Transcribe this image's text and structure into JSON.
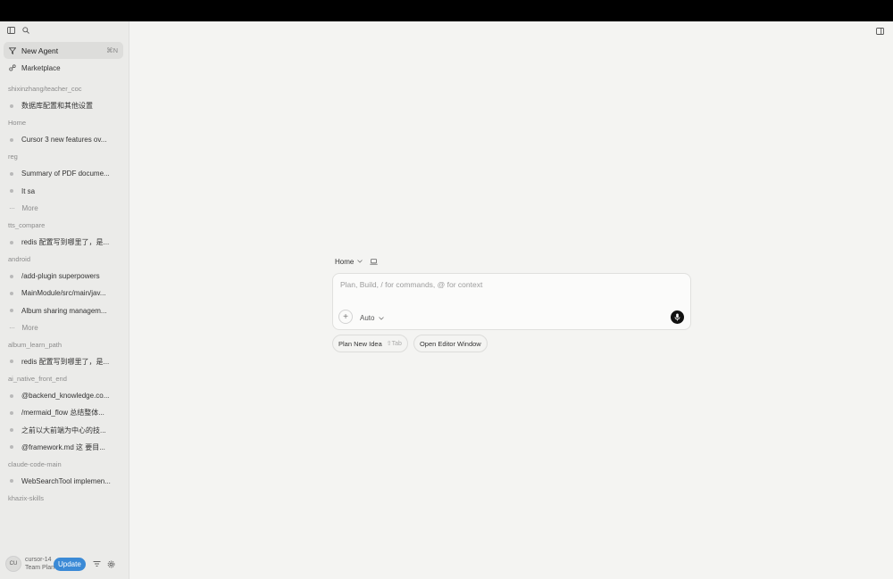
{
  "sidebar": {
    "new_agent": {
      "label": "New Agent",
      "shortcut": "⌘N"
    },
    "marketplace": {
      "label": "Marketplace"
    },
    "groups": [
      {
        "title": "shixinzhang/teacher_coc",
        "items": [
          {
            "label": "数据库配置和其他设置"
          }
        ]
      },
      {
        "title": "Home",
        "items": [
          {
            "label": "Cursor 3 new features ov..."
          }
        ]
      },
      {
        "title": "reg",
        "items": [
          {
            "label": "Summary of PDF docume..."
          },
          {
            "label": "It sa"
          }
        ],
        "more": "More"
      },
      {
        "title": "tts_compare",
        "items": [
          {
            "label": "redis 配置写到哪里了，是..."
          }
        ]
      },
      {
        "title": "android",
        "items": [
          {
            "label": "/add-plugin superpowers"
          },
          {
            "label": "MainModule/src/main/jav..."
          },
          {
            "label": "Album sharing managem..."
          }
        ],
        "more": "More"
      },
      {
        "title": "album_learn_path",
        "items": [
          {
            "label": "redis 配置写到哪里了，是..."
          }
        ]
      },
      {
        "title": "ai_native_front_end",
        "items": [
          {
            "label": "@backend_knowledge.co..."
          },
          {
            "label": "/mermaid_flow 总结整体..."
          },
          {
            "label": "之前以大前端为中心的技..."
          },
          {
            "label": "@framework.md 这   要目..."
          }
        ]
      },
      {
        "title": "claude-code-main",
        "items": [
          {
            "label": "WebSearchTool implemen..."
          }
        ]
      },
      {
        "title": "khazix-skills",
        "items": []
      }
    ],
    "footer": {
      "avatar_initials": "CU",
      "user_name": "cursor-14",
      "plan": "Team Plan",
      "update_label": "Update"
    }
  },
  "main": {
    "context_label": "Home",
    "composer": {
      "placeholder": "Plan, Build, / for commands, @ for context",
      "mode": "Auto"
    },
    "actions": [
      {
        "label": "Plan New Idea",
        "hint": "⇧Tab"
      },
      {
        "label": "Open Editor Window",
        "hint": ""
      }
    ]
  },
  "colors": {
    "accent": "#3b8ad6",
    "sidebar_bg": "#ebebe9",
    "main_bg": "#f4f4f2"
  }
}
